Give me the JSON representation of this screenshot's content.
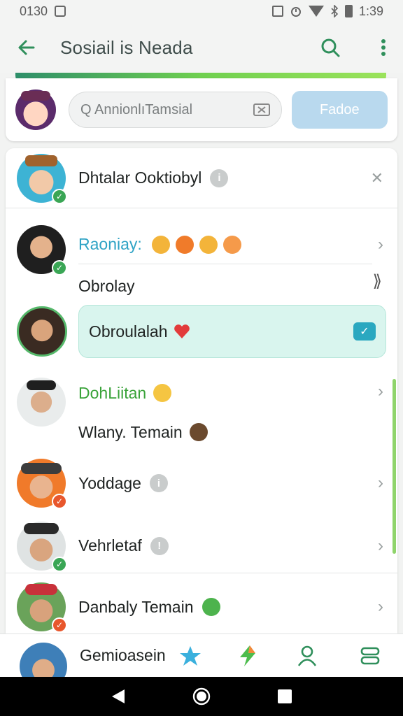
{
  "status_bar": {
    "time_left": "0130",
    "time_right": "1:39",
    "icons": [
      "photo-icon",
      "no-sim-icon",
      "alarm-icon",
      "wifi-icon",
      "bluetooth-icon",
      "battery-icon"
    ]
  },
  "app_bar": {
    "title": "Sosiail is Neada",
    "back_icon": "back-arrow-icon",
    "search_icon": "search-icon",
    "menu_icon": "more-vert-icon"
  },
  "search": {
    "placeholder": "Q AnnionlıTamsial",
    "button_label": "Fadoe"
  },
  "colors": {
    "accent_green": "#2f8f5b",
    "teal": "#2fa3c5",
    "bubble": "#d9f5ee",
    "button": "#b9d9ee"
  },
  "contacts": [
    {
      "name": "Dhtalar Ooktiobyl",
      "badge": "check",
      "trailing": "close-icon",
      "extra": "info-icon"
    },
    {
      "name": "Raoniay:",
      "badge": "check",
      "trailing": "chevron-right-icon",
      "extra": "emoji-row",
      "subtitle": "Obrolay",
      "subtitle_icon": "tag-arrow-icon"
    },
    {
      "name": "Obroulalah",
      "badge": "none",
      "trailing": "chat-check-icon",
      "extra": "heart-icon"
    },
    {
      "name": "DohLiitan",
      "badge": "none",
      "trailing": "chevron-right-icon",
      "extra": "emoji-icon",
      "subtitle": "Wlany. Temain",
      "subtitle_icon": "owl-emoji-icon"
    },
    {
      "name": "Yoddage",
      "badge": "cross",
      "trailing": "chevron-right-icon",
      "extra": "info-icon"
    },
    {
      "name": "Vehrletaf",
      "badge": "check",
      "trailing": "chevron-right-icon",
      "extra": "info-icon"
    },
    {
      "name": "Danbaly Temain",
      "badge": "cross",
      "trailing": "chevron-right-icon",
      "extra": "smile-icon"
    }
  ],
  "bottom_bar": {
    "name": "Gemioasein",
    "icons": [
      "star-icon",
      "lightning-icon",
      "person-icon",
      "stack-icon"
    ]
  },
  "nav_bar": {
    "icons": [
      "back-triangle-icon",
      "home-circle-icon",
      "recents-square-icon"
    ]
  }
}
